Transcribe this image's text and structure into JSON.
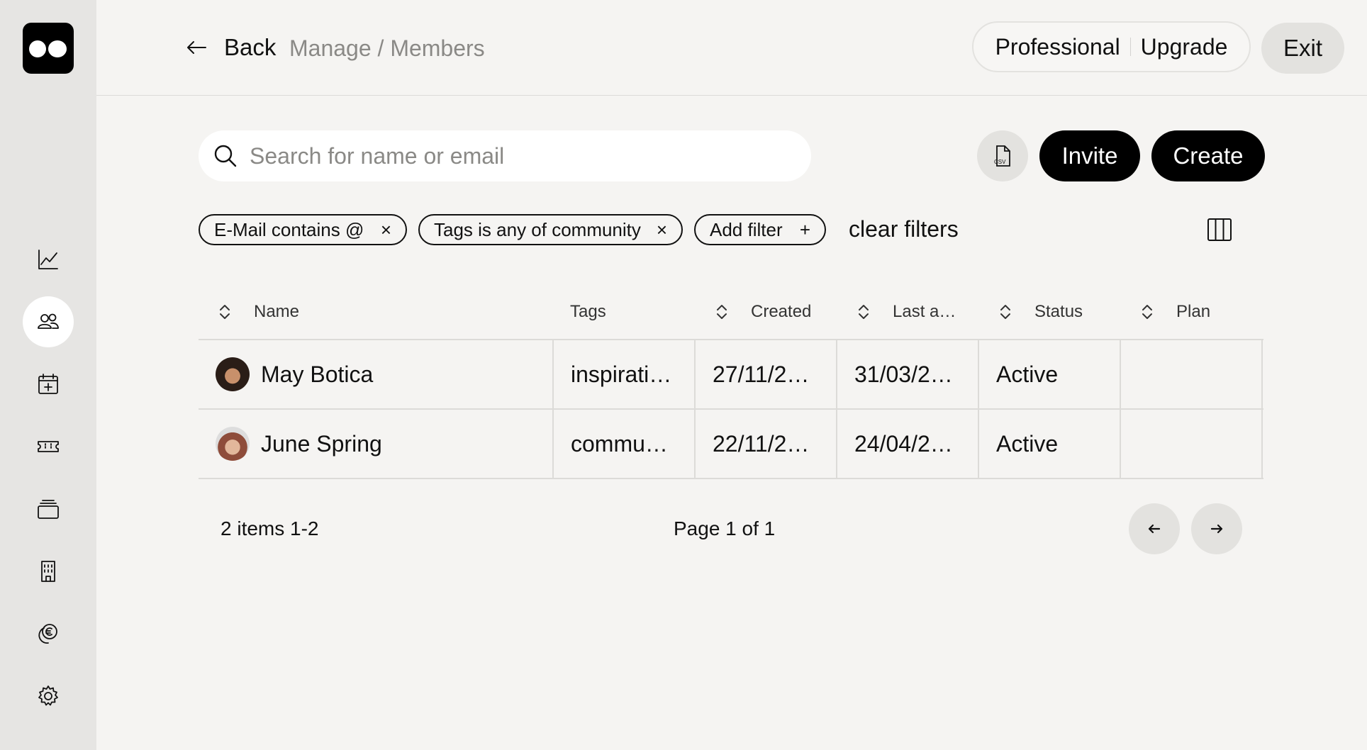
{
  "header": {
    "back_label": "Back",
    "breadcrumb": "Manage / Members",
    "plan_name": "Professional",
    "upgrade_label": "Upgrade",
    "exit_label": "Exit"
  },
  "sidebar": {
    "items": [
      {
        "icon": "chart-line-icon"
      },
      {
        "icon": "members-icon",
        "active": true
      },
      {
        "icon": "calendar-add-icon"
      },
      {
        "icon": "ticket-icon"
      },
      {
        "icon": "stack-icon"
      },
      {
        "icon": "building-icon"
      },
      {
        "icon": "euro-coins-icon"
      },
      {
        "icon": "gear-icon"
      }
    ]
  },
  "toolbar": {
    "search_placeholder": "Search for name or email",
    "search_value": "",
    "csv_icon": "csv-file-icon",
    "invite_label": "Invite",
    "create_label": "Create"
  },
  "filters": {
    "chips": [
      {
        "label": "E-Mail contains @",
        "action": "×"
      },
      {
        "label": "Tags is any of community",
        "action": "×"
      },
      {
        "label": "Add filter",
        "action": "+"
      }
    ],
    "clear_label": "clear filters"
  },
  "table": {
    "columns": [
      "Name",
      "Tags",
      "Created",
      "Last a…",
      "Status",
      "Plan"
    ],
    "rows": [
      {
        "name": "May Botica",
        "tags": "inspirati…",
        "created": "27/11/2…",
        "last": "31/03/2…",
        "status": "Active",
        "plan": ""
      },
      {
        "name": "June Spring",
        "tags": "commu…",
        "created": "22/11/2…",
        "last": "24/04/2…",
        "status": "Active",
        "plan": ""
      }
    ]
  },
  "footer": {
    "count": "2 items 1-2",
    "page": "Page 1 of 1"
  }
}
